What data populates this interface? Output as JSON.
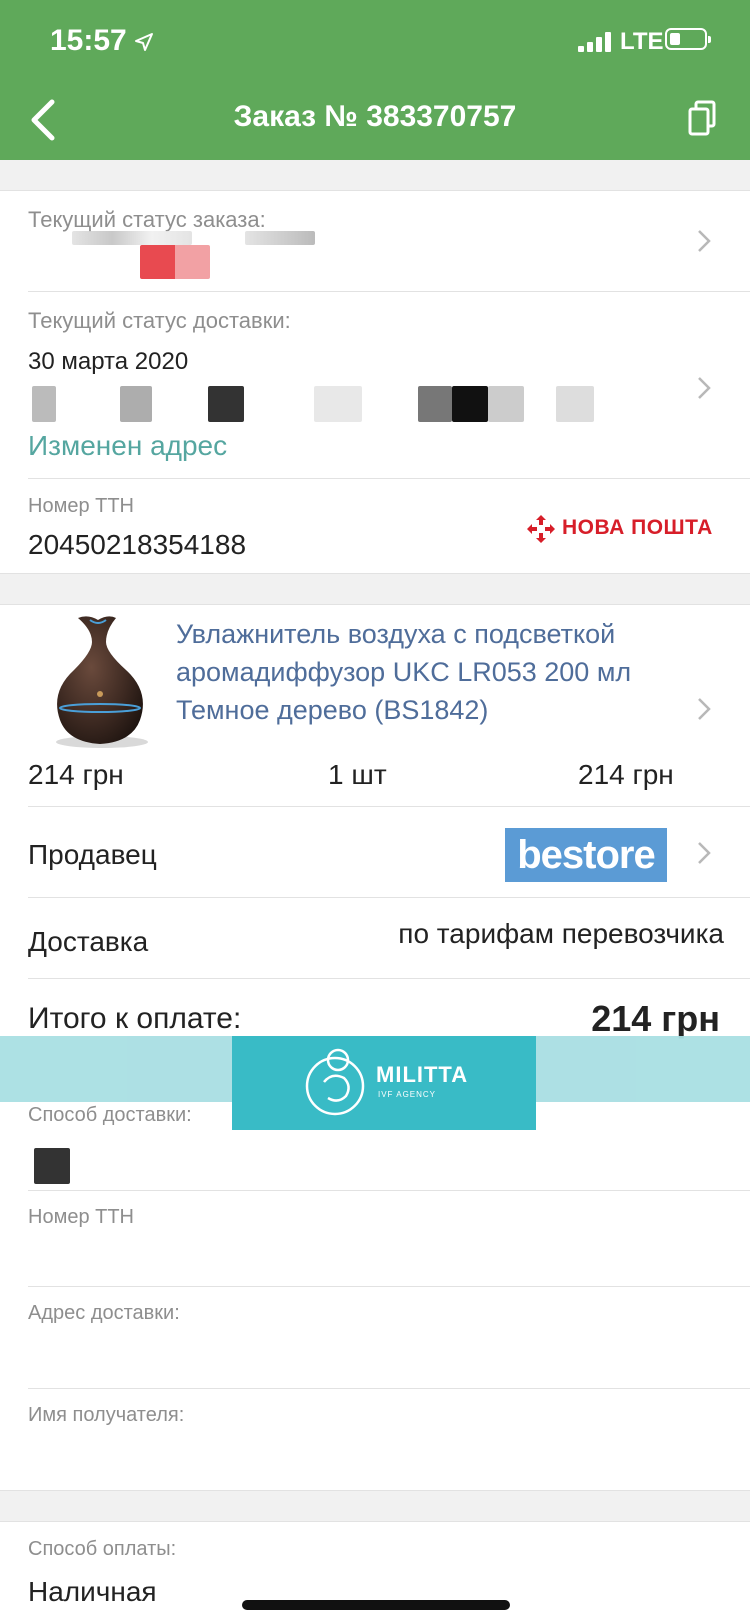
{
  "status_bar": {
    "time": "15:57",
    "network": "LTE"
  },
  "nav": {
    "title": "Заказ № 383370757"
  },
  "order_status": {
    "label": "Текущий статус заказа:"
  },
  "delivery_status": {
    "label": "Текущий статус доставки:",
    "date": "30 марта 2020",
    "changed_link": "Изменен адрес"
  },
  "ttn": {
    "label": "Номер ТТН",
    "value": "20450218354188",
    "carrier": "НОВА ПОШТА"
  },
  "product": {
    "title": "Увлажнитель воздуха с подсветкой аромадиффузор UKC LR053 200 мл Темное дерево (BS1842)",
    "unit_price": "214 грн",
    "quantity": "1 шт",
    "line_total": "214 грн"
  },
  "seller": {
    "label": "Продавец",
    "brand": "bestore"
  },
  "delivery": {
    "label": "Доставка",
    "value": "по тарифам перевозчика"
  },
  "total": {
    "label": "Итого к оплате:",
    "value": "214 грн"
  },
  "watermark": {
    "name": "MILITTA",
    "sub": "IVF AGENCY"
  },
  "shipping": {
    "method_label": "Способ доставки:",
    "ttn_label": "Номер ТТН",
    "address_label": "Адрес доставки:",
    "recipient_label": "Имя получателя:"
  },
  "payment": {
    "label": "Способ оплаты:",
    "value": "Наличная"
  },
  "colors": {
    "header_green": "#5fa95a",
    "link_blue": "#4f6d9a",
    "status_teal": "#55a6a0",
    "nova_red": "#d71e29",
    "bestore_blue": "#5b9bd5"
  }
}
